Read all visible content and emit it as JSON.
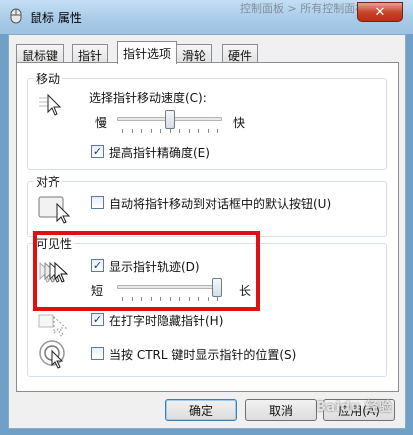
{
  "window": {
    "title": "鼠标 属性",
    "background_title_fragment": "控制面板 > 所有控制面板项",
    "close_label": "✕"
  },
  "tabs": [
    {
      "label": "鼠标键",
      "active": false
    },
    {
      "label": "指针",
      "active": false
    },
    {
      "label": "指针选项",
      "active": true
    },
    {
      "label": "滑轮",
      "active": false
    },
    {
      "label": "硬件",
      "active": false
    }
  ],
  "motion": {
    "group_title": "移动",
    "speed_label": "选择指针移动速度(C):",
    "slow_label": "慢",
    "fast_label": "快",
    "speed_level": 0.5,
    "precision_label": "提高指针精确度(E)",
    "precision_checked": true
  },
  "snap_to": {
    "group_title": "对齐",
    "auto_move_label": "自动将指针移动到对话框中的默认按钮(U)",
    "auto_move_checked": false
  },
  "visibility": {
    "group_title": "可见性",
    "trails_label": "显示指针轨迹(D)",
    "trails_checked": true,
    "short_label": "短",
    "long_label": "长",
    "trail_length_level": 1.0,
    "hide_typing_label": "在打字时隐藏指针(H)",
    "hide_typing_checked": true,
    "ctrl_show_label": "当按 CTRL 键时显示指针的位置(S)",
    "ctrl_show_checked": false
  },
  "buttons": {
    "ok": "确定",
    "cancel": "取消",
    "apply": "应用(A)"
  },
  "watermark": "Baidu 经验",
  "colors": {
    "highlight": "#e01010",
    "accent": "#3c7fb1"
  }
}
